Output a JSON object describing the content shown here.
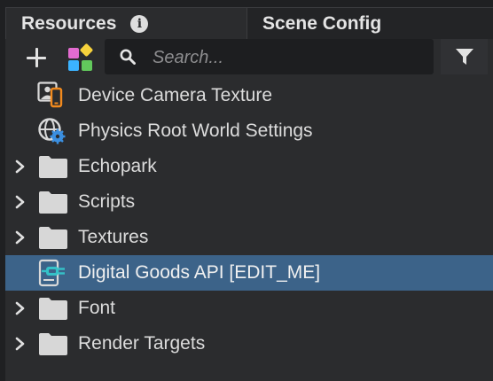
{
  "tabs": [
    {
      "label": "Resources",
      "active": true
    },
    {
      "label": "Scene Config",
      "active": false
    }
  ],
  "toolbar": {
    "search_placeholder": "Search...",
    "search_value": ""
  },
  "tree": {
    "items": [
      {
        "label": "Device Camera Texture",
        "type": "device-camera-texture",
        "expandable": false,
        "selected": false
      },
      {
        "label": "Physics Root World Settings",
        "type": "physics-world-settings",
        "expandable": false,
        "selected": false
      },
      {
        "label": "Echopark",
        "type": "folder",
        "expandable": true,
        "selected": false
      },
      {
        "label": "Scripts",
        "type": "folder",
        "expandable": true,
        "selected": false
      },
      {
        "label": "Textures",
        "type": "folder",
        "expandable": true,
        "selected": false
      },
      {
        "label": "Digital Goods API [EDIT_ME]",
        "type": "script-asset",
        "expandable": false,
        "selected": true
      },
      {
        "label": "Font",
        "type": "folder",
        "expandable": true,
        "selected": false
      },
      {
        "label": "Render Targets",
        "type": "folder",
        "expandable": true,
        "selected": false
      }
    ]
  },
  "colors": {
    "panel_bg": "#2b2c2e",
    "selection": "#3c6389",
    "folder": "#d7d7d7",
    "accent_blue": "#3b8fe0",
    "camera_orange": "#f28a1e",
    "script_teal": "#35c2c8"
  }
}
